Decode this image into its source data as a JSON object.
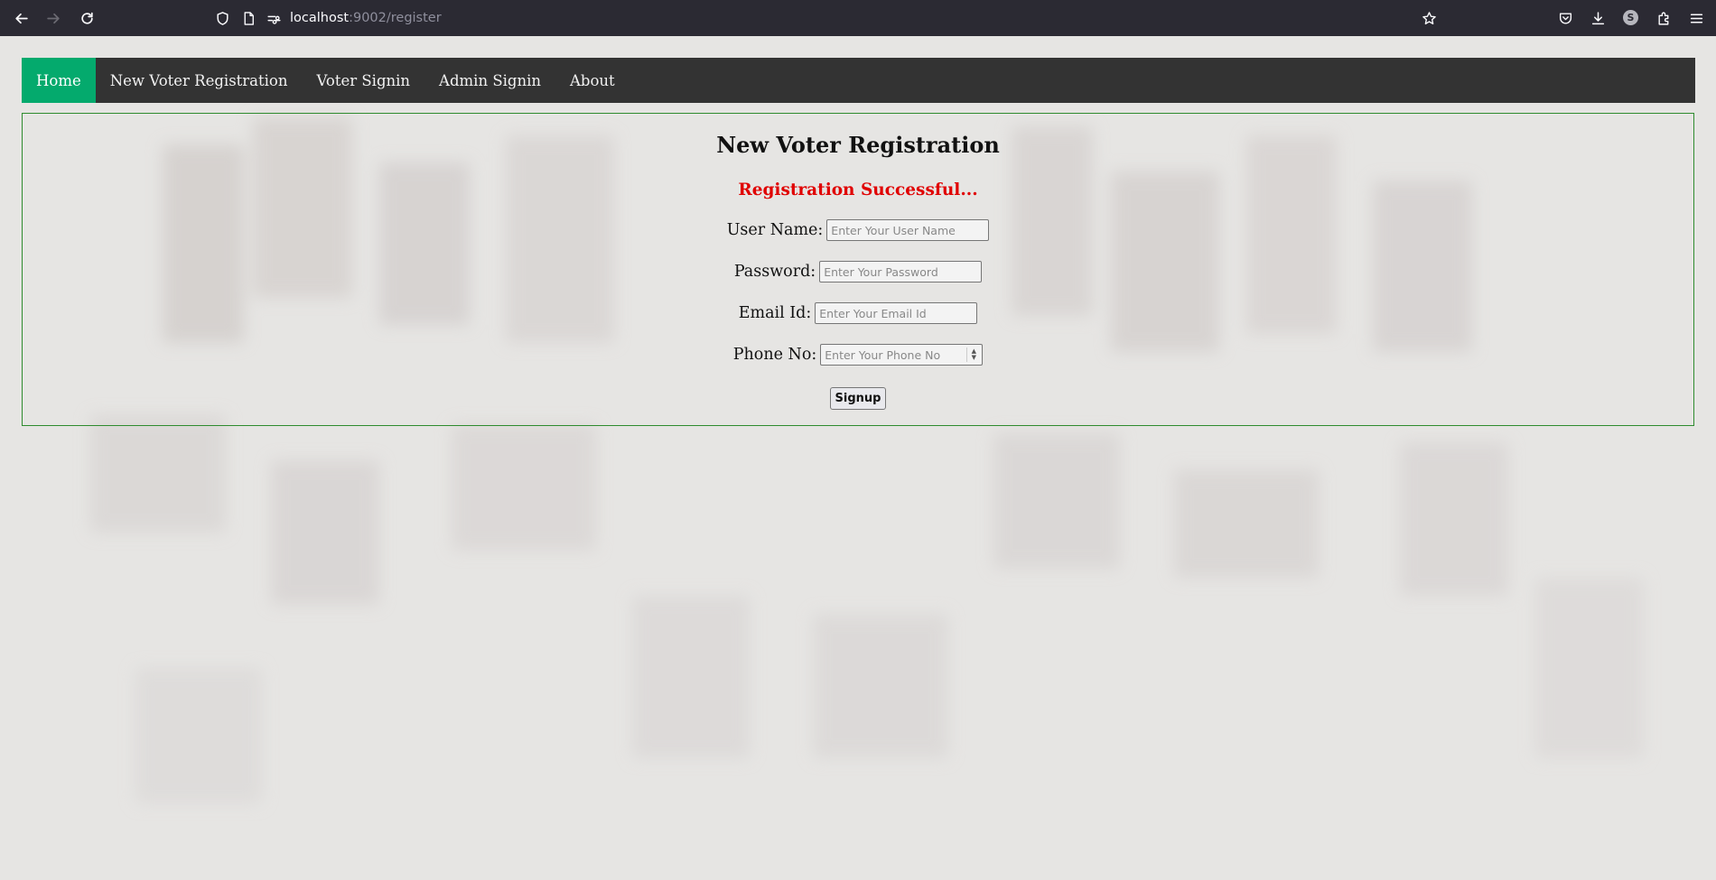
{
  "browser": {
    "url_host": "localhost",
    "url_rest": ":9002/register",
    "profile_initial": "S",
    "icons": [
      "back-arrow-icon",
      "forward-arrow-icon",
      "reload-icon",
      "shield-icon",
      "page-icon",
      "permissions-icon",
      "bookmark-star-icon",
      "pocket-icon",
      "download-icon",
      "avatar-icon",
      "extensions-icon",
      "menu-icon"
    ]
  },
  "nav": {
    "items": [
      {
        "label": "Home",
        "active": true
      },
      {
        "label": "New Voter Registration",
        "active": false
      },
      {
        "label": "Voter Signin",
        "active": false
      },
      {
        "label": "Admin Signin",
        "active": false
      },
      {
        "label": "About",
        "active": false
      }
    ]
  },
  "form": {
    "title": "New Voter Registration",
    "status_message": "Registration Successful...",
    "fields": [
      {
        "label": "User Name:",
        "placeholder": "Enter Your User Name",
        "value": ""
      },
      {
        "label": "Password:",
        "placeholder": "Enter Your Password",
        "value": ""
      },
      {
        "label": "Email Id:",
        "placeholder": "Enter Your Email Id",
        "value": ""
      },
      {
        "label": "Phone No:",
        "placeholder": "Enter Your Phone No",
        "value": ""
      }
    ],
    "submit_label": "Signup"
  },
  "colors": {
    "nav_active": "#04aa6d",
    "nav_bg": "#333333",
    "status": "#e00000",
    "panel_border": "#2e8b2e"
  }
}
